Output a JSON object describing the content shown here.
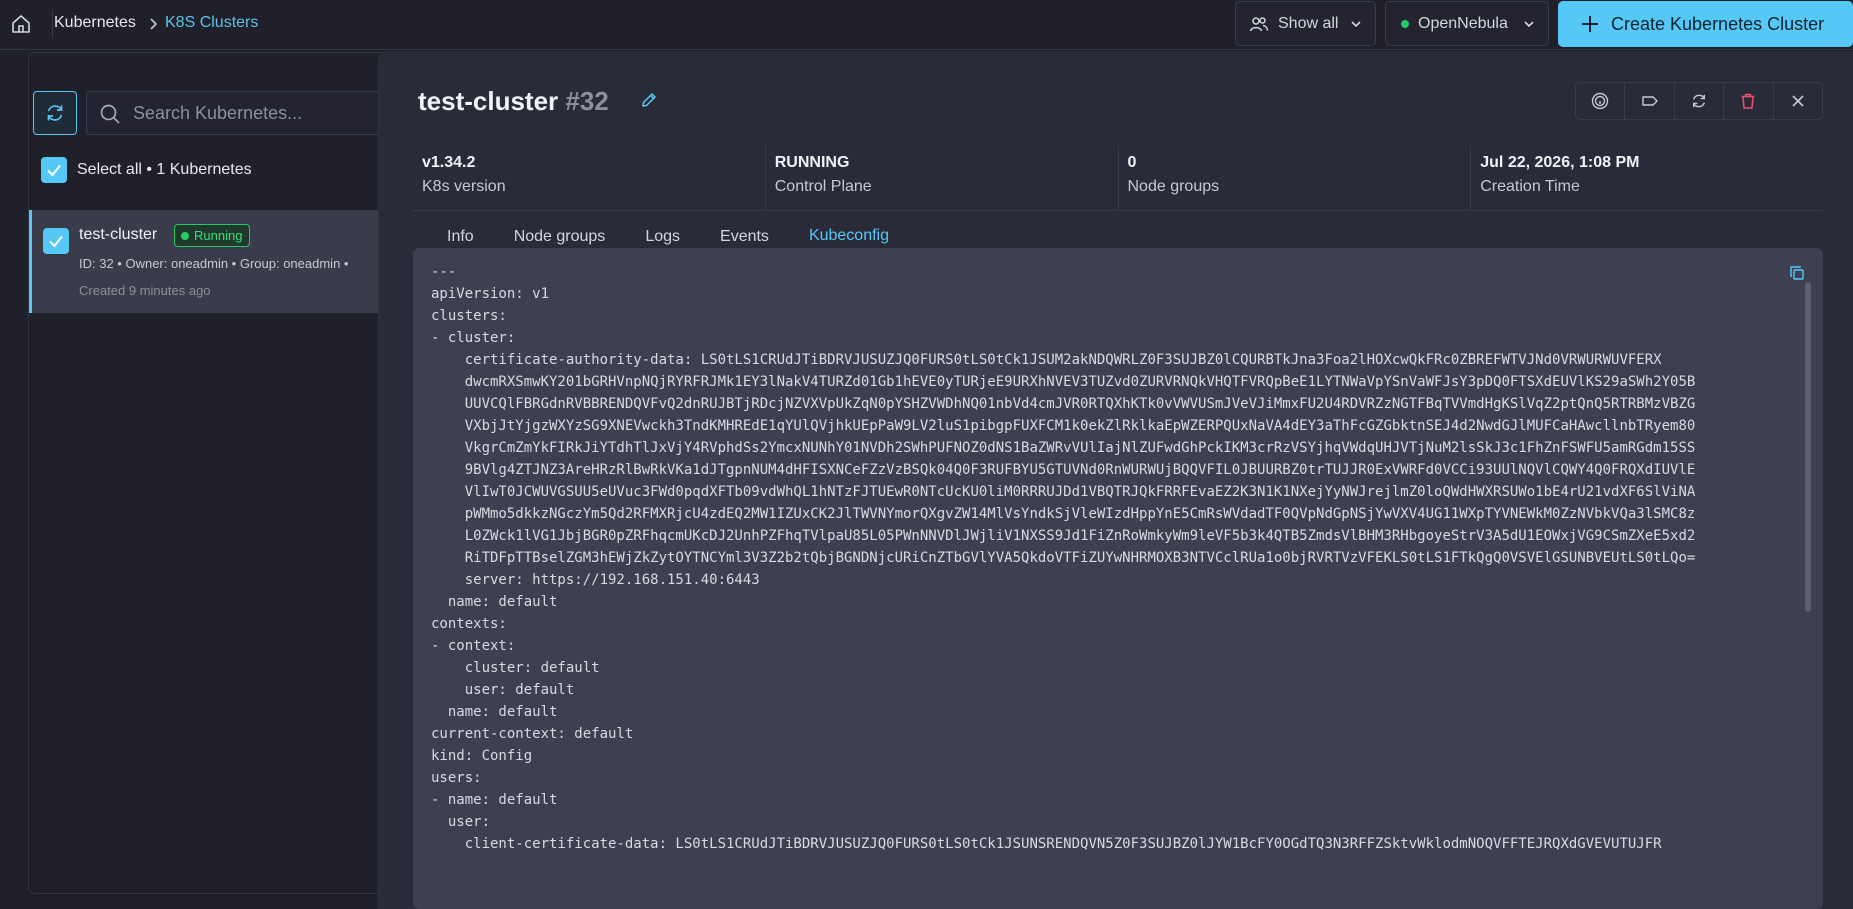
{
  "breadcrumb": {
    "home_icon": "home-icon",
    "root": "Kubernetes",
    "current": "K8S Clusters"
  },
  "header": {
    "filter_label": "Show all",
    "provider_label": "OpenNebula",
    "create_label": "Create Kubernetes Cluster"
  },
  "list": {
    "search_placeholder": "Search Kubernetes...",
    "select_all_label": "Select all • 1 Kubernetes",
    "items": [
      {
        "name": "test-cluster",
        "status": "Running",
        "meta": "ID: 32  •  Owner: oneadmin  •  Group: oneadmin  •",
        "created": "Created 9 minutes ago"
      }
    ]
  },
  "detail": {
    "title": "test-cluster",
    "id": "#32",
    "stats": [
      {
        "value": "v1.34.2",
        "label": "K8s version"
      },
      {
        "value": "RUNNING",
        "label": "Control Plane"
      },
      {
        "value": "0",
        "label": "Node groups"
      },
      {
        "value": "Jul 22, 2026, 1:08 PM",
        "label": "Creation Time"
      }
    ],
    "tabs": [
      "Info",
      "Node groups",
      "Logs",
      "Events",
      "Kubeconfig"
    ],
    "active_tab": "Kubeconfig",
    "kubeconfig_lines": [
      "---",
      "apiVersion: v1",
      "clusters:",
      "- cluster:",
      "    certificate-authority-data: LS0tLS1CRUdJTiBDRVJUSUZJQ0FURS0tLS0tCk1JSUM2akNDQWRLZ0F3SUJBZ0lCQURBTkJna3Foa2lHOXcwQkFRc0ZBREFWTVJNd0VRWURWUVFERX",
      "    dwcmRXSmwKY201bGRHVnpNQjRYRFRJMk1EY3lNakV4TURZd01Gb1hEVE0yTURjeE9URXhNVEV3TUZvd0ZURVRNQkVHQTFVRQpBeE1LYTNWaVpYSnVaWFJsY3pDQ0FTSXdEUVlKS29aSWh2Y05B",
      "    UUVCQlFBRGdnRVBBRENDQVFvQ2dnRUJBTjRDcjNZVXVpUkZqN0pYSHZVWDhNQ01nbVd4cmJVR0RTQXhKTk0vVWVUSmJVeVJiMmxFU2U4RDVRZzNGTFBqTVVmdHgKSlVqZ2ptQnQ5RTRBMzVBZG",
      "    VXbjJtYjgzWXYzSG9XNEVwckh3TndKMHREdE1qYUlQVjhkUEpPaW9LV2luS1pibgpFUXFCM1k0ekZlRklkaEpWZERPQUxNaVA4dEY3aThFcGZGbktnSEJ4d2NwdGJlMUFCaHAwcllnbTRyem80",
      "    VkgrCmZmYkFIRkJiYTdhTlJxVjY4RVphdSs2YmcxNUNhY01NVDh2SWhPUFNOZ0dNS1BaZWRvVUlIajNlZUFwdGhPckIKM3crRzVSYjhqVWdqUHJVTjNuM2lsSkJ3c1FhZnFSWFU5amRGdm15SS",
      "    9BVlg4ZTJNZ3AreHRzRlBwRkVKa1dJTgpnNUM4dHFISXNCeFZzVzBSQk04Q0F3RUFBYU5GTUVNd0RnWURWUjBQQVFIL0JBUURBZ0trTUJJR0ExVWRFd0VCCi93UUlNQVlCQWY4Q0FRQXdIUVlE",
      "    VlIwT0JCWUVGSUU5eUVuc3FWd0pqdXFTb09vdWhQL1hNTzFJTUEwR0NTcUcKU0liM0RRRUJDd1VBQTRJQkFRRFEvaEZ2K3N1K1NXejYyNWJrejlmZ0loQWdHWXRSUWo1bE4rU21vdXF6SlViNA",
      "    pWMmo5dkkzNGczYm5Qd2RFMXRjcU4zdEQ2MW1IZUxCK2JlTWVNYmorQXgvZW14MlVsYndkSjVleWIzdHppYnE5CmRsWVdadTF0QVpNdGpNSjYwVXV4UG11WXpTYVNEWkM0ZzNVbkVQa3lSMC8z",
      "    L0ZWck1lVG1JbjBGR0pZRFhqcmUKcDJ2UnhPZFhqTVlpaU85L05PWnNNVDlJWjliV1NXSS9Jd1FiZnRoWmkyWm9leVF5b3k4QTB5ZmdsVlBHM3RHbgoyeStrV3A5dU1EOWxjVG9CSmZXeE5xd2",
      "    RiTDFpTTBselZGM3hEWjZkZytOYTNCYml3V3Z2b2tQbjBGNDNjcURiCnZTbGVlYVA5QkdoVTFiZUYwNHRMOXB3NTVCclRUa1o0bjRVRTVzVFEKLS0tLS1FTkQgQ0VSVElGSUNBVEUtLS0tLQo=",
      "    server: https://192.168.151.40:6443",
      "  name: default",
      "contexts:",
      "- context:",
      "    cluster: default",
      "    user: default",
      "  name: default",
      "current-context: default",
      "kind: Config",
      "users:",
      "- name: default",
      "  user:",
      "    client-certificate-data: LS0tLS1CRUdJTiBDRVJUSUZJQ0FURS0tLS0tCk1JSUNSRENDQVN5Z0F3SUJBZ0lJYW1BcFY0OGdTQ3N3RFFZSktvWklodmNOQVFFTEJRQXdGVEVUTUJFR"
    ]
  },
  "colors": {
    "accent": "#56c8f5",
    "running": "#28c864",
    "panel": "#2a2b38",
    "code_bg": "#3e4052"
  }
}
